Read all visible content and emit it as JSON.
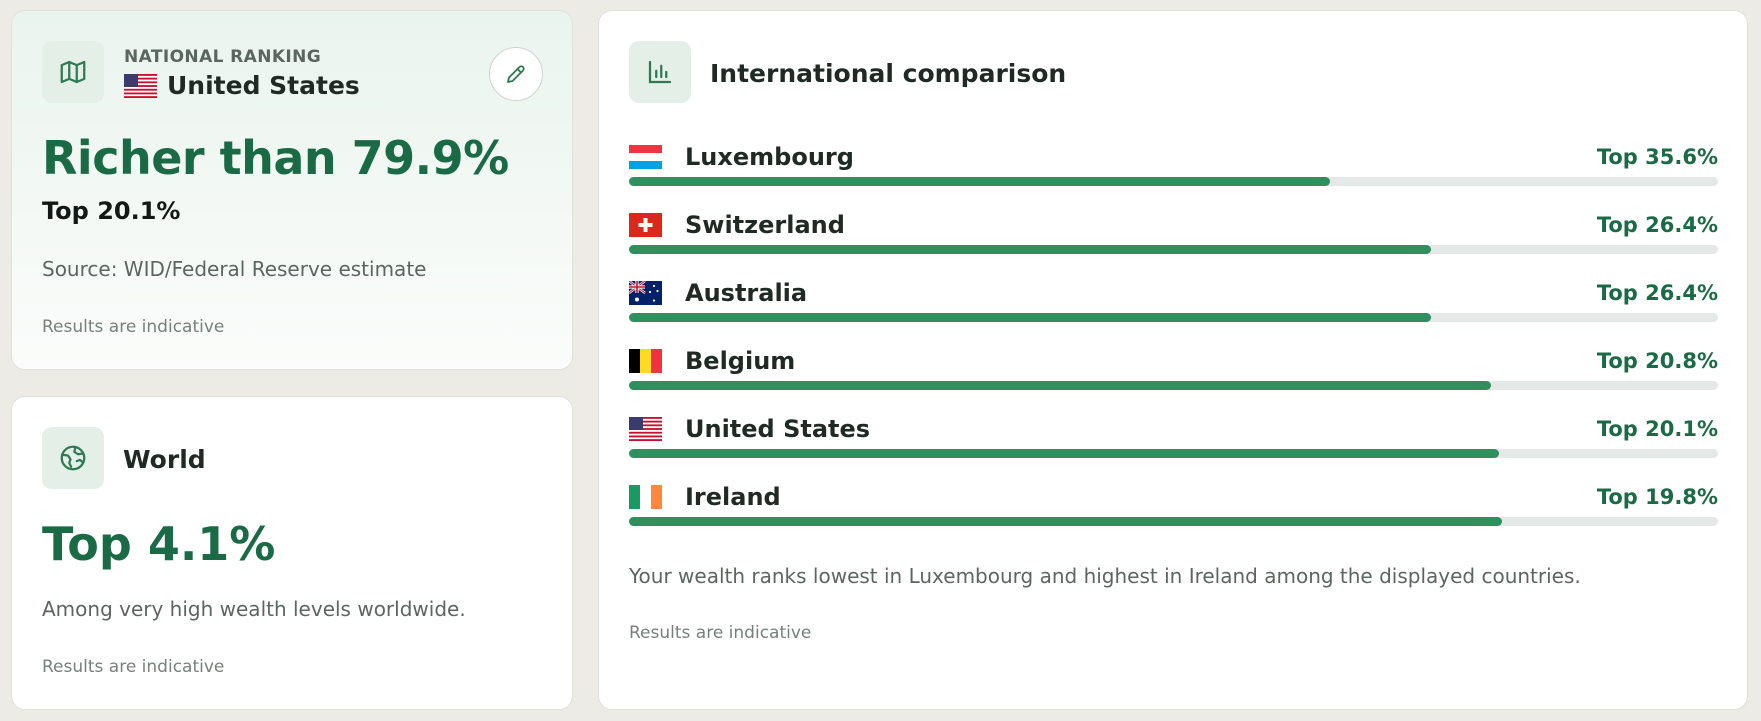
{
  "national": {
    "label": "NATIONAL RANKING",
    "country": "United States",
    "headline": "Richer than 79.9%",
    "top": "Top 20.1%",
    "source": "Source: WID/Federal Reserve estimate",
    "indicative": "Results are indicative",
    "icons": {
      "card": "map-icon",
      "edit": "pencil-icon",
      "flag": "flag-us-icon"
    }
  },
  "world": {
    "title": "World",
    "top": "Top 4.1%",
    "description": "Among very high wealth levels worldwide.",
    "indicative": "Results are indicative",
    "icons": {
      "card": "globe-icon"
    }
  },
  "international": {
    "title": "International comparison",
    "countries": [
      {
        "name": "Luxembourg",
        "value_label": "Top 35.6%",
        "fill_fraction": 0.644,
        "flag": "flag-lu-icon"
      },
      {
        "name": "Switzerland",
        "value_label": "Top 26.4%",
        "fill_fraction": 0.736,
        "flag": "flag-ch-icon"
      },
      {
        "name": "Australia",
        "value_label": "Top 26.4%",
        "fill_fraction": 0.736,
        "flag": "flag-au-icon"
      },
      {
        "name": "Belgium",
        "value_label": "Top 20.8%",
        "fill_fraction": 0.792,
        "flag": "flag-be-icon"
      },
      {
        "name": "United States",
        "value_label": "Top 20.1%",
        "fill_fraction": 0.799,
        "flag": "flag-us-icon"
      },
      {
        "name": "Ireland",
        "value_label": "Top 19.8%",
        "fill_fraction": 0.802,
        "flag": "flag-ie-icon"
      }
    ],
    "summary": "Your wealth ranks lowest in Luxembourg and highest in Ireland among the displayed countries.",
    "indicative": "Results are indicative",
    "icons": {
      "card": "bar-chart-icon"
    }
  },
  "colors": {
    "accent": "#1a6b45",
    "bar_fill": "#2f8f5d",
    "bar_track": "#e4e8e6",
    "icon_bg": "#e3efe7"
  }
}
